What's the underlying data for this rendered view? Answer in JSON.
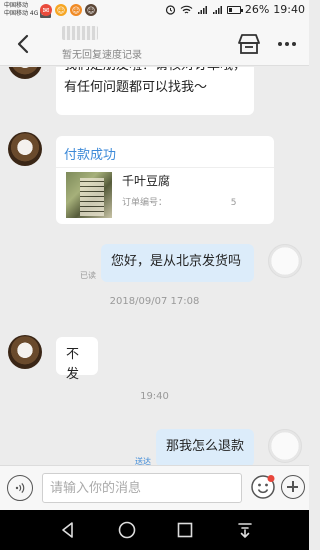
{
  "status_bar": {
    "carrier_1": "中国移动",
    "carrier_2": "中国移动 4G",
    "lte": "LTE",
    "battery": "26%",
    "time": "19:40",
    "notification_icons": [
      "app-notification-red",
      "app-notification-yellow",
      "app-notification-orange",
      "app-notification-brown"
    ]
  },
  "header": {
    "status": "暂无回复速度记录"
  },
  "messages": {
    "m1_text": "我们是朋友啦！请核对订单哦，有任何问题都可以找我～",
    "card_title": "付款成功",
    "card_product": "千叶豆腐",
    "card_order_label": "订单编号：",
    "card_order_digit": "5",
    "m2_text": "您好，是从北京发货吗",
    "m2_receipt": "已读",
    "time_1": "2018/09/07 17:08",
    "m3_text": "不发",
    "time_2": "19:40",
    "m4_text": "那我怎么退款",
    "m4_receipt": "送达"
  },
  "input": {
    "placeholder": "请输入你的消息"
  },
  "colors": {
    "accent": "#3d8ad8",
    "own_bubble": "#dcecfa",
    "background": "#ececec"
  }
}
